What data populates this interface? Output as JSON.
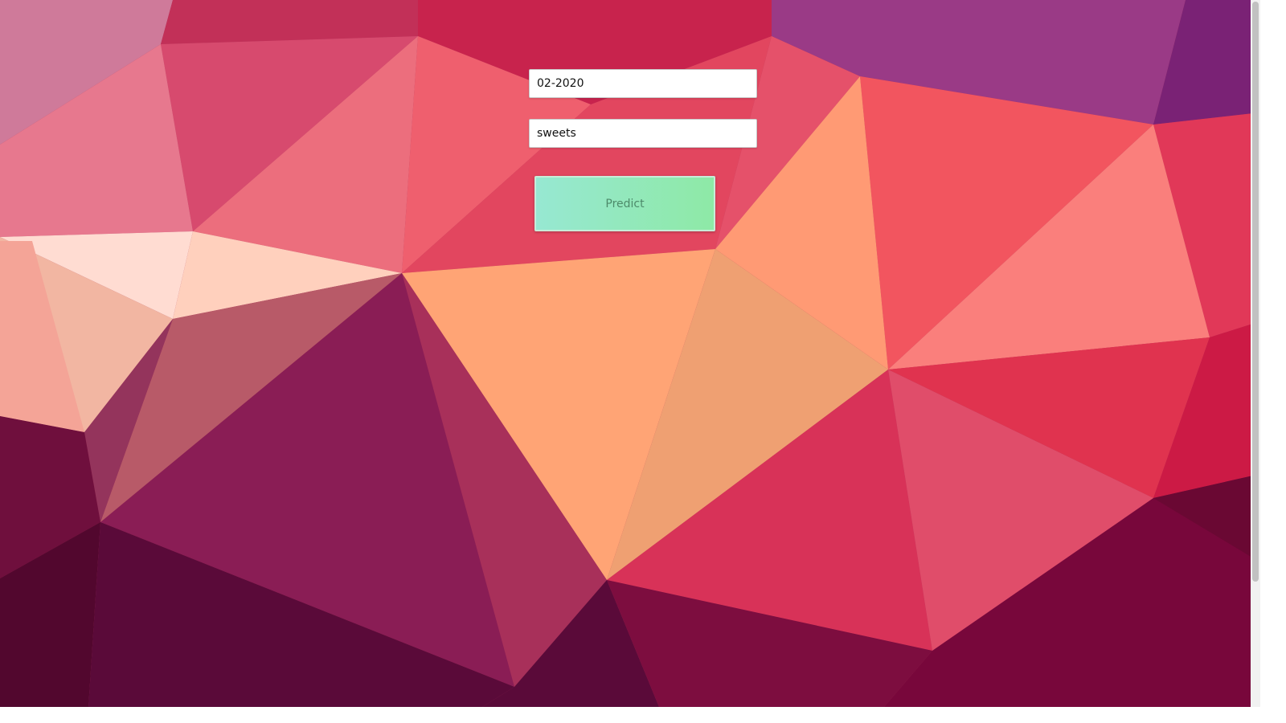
{
  "form": {
    "date_value": "02-2020",
    "category_value": "sweets",
    "predict_label": "Predict"
  },
  "colors": {
    "button_gradient_start": "#97e8d2",
    "button_gradient_end": "#8ee9a6",
    "button_text": "#4d8a6a"
  },
  "background": {
    "style": "low-poly geometric pattern in pink, magenta, coral and peach"
  }
}
